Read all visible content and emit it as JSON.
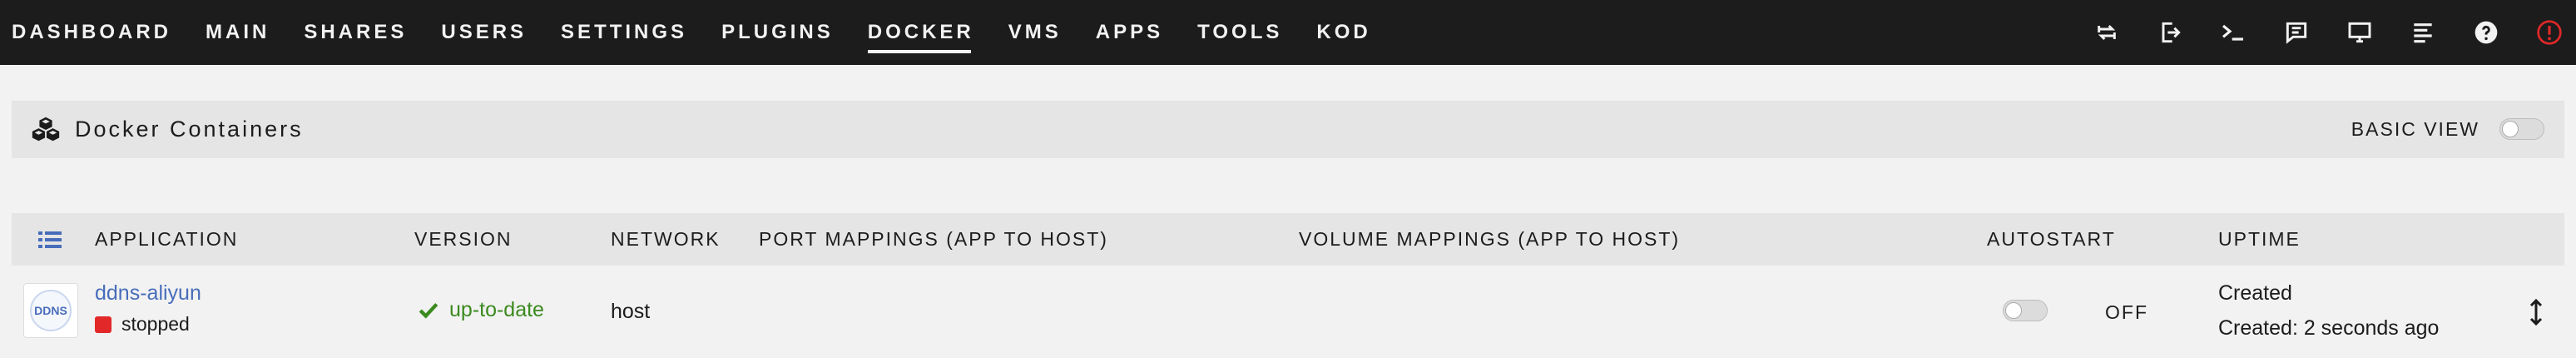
{
  "nav": {
    "items": [
      {
        "label": "DASHBOARD"
      },
      {
        "label": "MAIN"
      },
      {
        "label": "SHARES"
      },
      {
        "label": "USERS"
      },
      {
        "label": "SETTINGS"
      },
      {
        "label": "PLUGINS"
      },
      {
        "label": "DOCKER",
        "active": true
      },
      {
        "label": "VMS"
      },
      {
        "label": "APPS"
      },
      {
        "label": "TOOLS"
      },
      {
        "label": "KOD"
      }
    ],
    "icons": [
      "switch-icon",
      "logout-icon",
      "terminal-icon",
      "feedback-icon",
      "monitor-icon",
      "log-icon",
      "help-icon",
      "alert-icon"
    ]
  },
  "panel": {
    "title": "Docker Containers",
    "basic_view_label": "BASIC VIEW",
    "basic_view_on": false
  },
  "table": {
    "headers": {
      "application": "APPLICATION",
      "version": "VERSION",
      "network": "NETWORK",
      "port_mappings": "PORT MAPPINGS (APP TO HOST)",
      "volume_mappings": "VOLUME MAPPINGS (APP TO HOST)",
      "autostart": "AUTOSTART",
      "uptime": "UPTIME"
    },
    "rows": [
      {
        "thumb_text": "DDNS",
        "name": "ddns-aliyun",
        "status": "stopped",
        "version": "up-to-date",
        "network": "host",
        "autostart": "OFF",
        "uptime_line1": "Created",
        "uptime_line2": "Created: 2 seconds ago"
      }
    ]
  },
  "colors": {
    "topbar": "#1c1c1c",
    "link": "#486dba",
    "ok": "#3b8a1f",
    "stopped": "#e22828",
    "alert": "#e22828"
  }
}
